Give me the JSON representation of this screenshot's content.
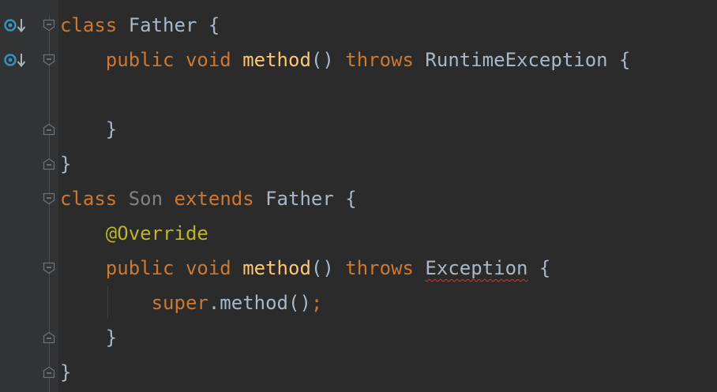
{
  "editor": {
    "lines": [
      {
        "tokens": [
          [
            "class ",
            "kw"
          ],
          [
            "Father",
            "cls"
          ],
          [
            " {",
            "cls"
          ]
        ]
      },
      {
        "tokens": [
          [
            "    ",
            ""
          ],
          [
            "public ",
            "kw"
          ],
          [
            "void ",
            "kw"
          ],
          [
            "method",
            "fn"
          ],
          [
            "() ",
            "cls"
          ],
          [
            "throws ",
            "kw"
          ],
          [
            "RuntimeException",
            "cls"
          ],
          [
            " {",
            "cls"
          ]
        ]
      },
      {
        "tokens": []
      },
      {
        "tokens": [
          [
            "    ",
            ""
          ],
          [
            "}",
            "cls"
          ]
        ]
      },
      {
        "tokens": [
          [
            "}",
            "cls"
          ]
        ]
      },
      {
        "tokens": [
          [
            "class ",
            "kw"
          ],
          [
            "Son",
            "unused"
          ],
          [
            " ",
            ""
          ],
          [
            "extends ",
            "kw"
          ],
          [
            "Father",
            "cls"
          ],
          [
            " {",
            "cls"
          ]
        ]
      },
      {
        "tokens": [
          [
            "    ",
            ""
          ],
          [
            "@Override",
            "ann"
          ]
        ]
      },
      {
        "tokens": [
          [
            "    ",
            ""
          ],
          [
            "public ",
            "kw"
          ],
          [
            "void ",
            "kw"
          ],
          [
            "method",
            "fn"
          ],
          [
            "() ",
            "cls"
          ],
          [
            "throws ",
            "kw"
          ],
          [
            "Exception",
            "err"
          ],
          [
            " {",
            "cls"
          ]
        ]
      },
      {
        "tokens": [
          [
            "        ",
            ""
          ],
          [
            "super",
            "kw"
          ],
          [
            ".method()",
            "cls"
          ],
          [
            ";",
            "semi"
          ]
        ]
      },
      {
        "tokens": [
          [
            "    ",
            ""
          ],
          [
            "}",
            "cls"
          ]
        ]
      },
      {
        "tokens": [
          [
            "}",
            "cls"
          ]
        ]
      }
    ],
    "gutter_icons": [
      {
        "line": 0,
        "icon": "overridden-method-icon"
      },
      {
        "line": 1,
        "icon": "overridden-method-icon"
      }
    ],
    "fold_markers": [
      {
        "line": 0,
        "type": "fold-start"
      },
      {
        "line": 1,
        "type": "fold-start"
      },
      {
        "line": 3,
        "type": "fold-end"
      },
      {
        "line": 4,
        "type": "fold-end"
      },
      {
        "line": 5,
        "type": "fold-start"
      },
      {
        "line": 7,
        "type": "fold-start"
      },
      {
        "line": 9,
        "type": "fold-end"
      },
      {
        "line": 10,
        "type": "fold-end"
      }
    ],
    "colors": {
      "background": "#2b2b2b",
      "keyword": "#cc7832",
      "text": "#a9b7c6",
      "method_declaration": "#ffc66d",
      "annotation": "#bbb529",
      "unused": "#808080",
      "error_underline": "#bc3f3c",
      "gutter_icon": "#3592c4"
    }
  }
}
